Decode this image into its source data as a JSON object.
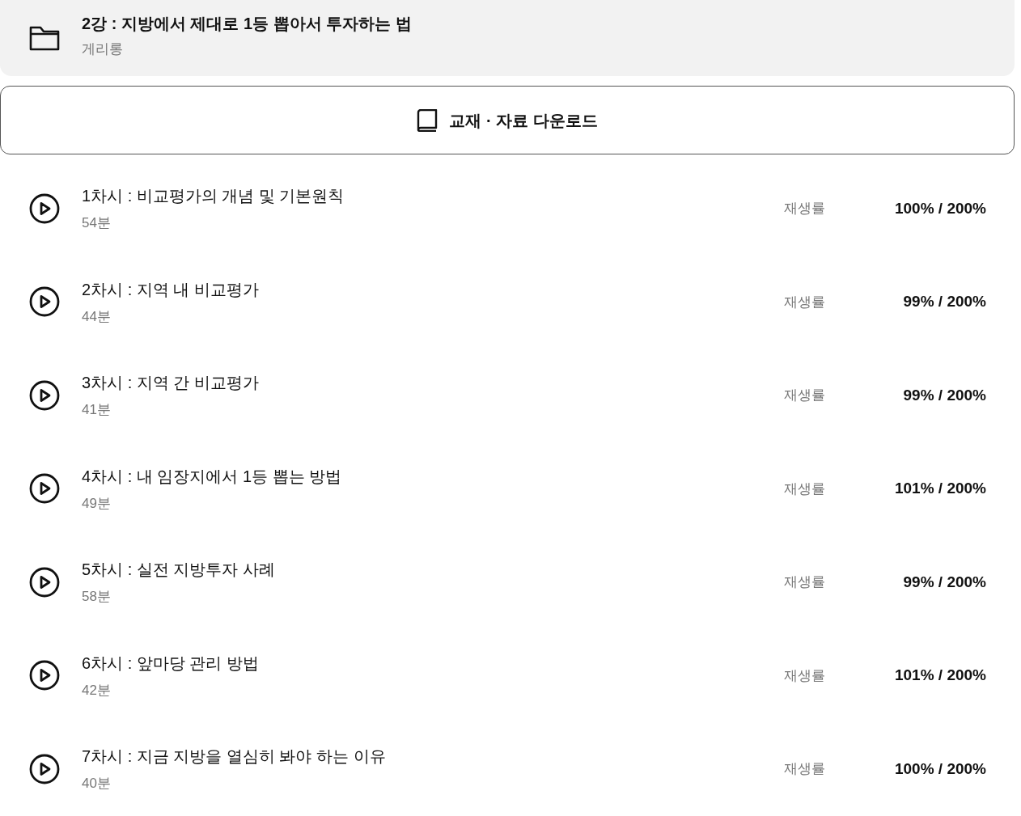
{
  "course": {
    "title": "2강 : 지방에서 제대로 1등 뽑아서 투자하는 법",
    "author": "게리롱"
  },
  "download_button": {
    "label": "교재 · 자료 다운로드"
  },
  "lessons": [
    {
      "title": "1차시 : 비교평가의 개념 및 기본원칙",
      "duration": "54분",
      "rate_label": "재생률",
      "rate": "100% / 200%"
    },
    {
      "title": "2차시 : 지역 내 비교평가",
      "duration": "44분",
      "rate_label": "재생률",
      "rate": "99% / 200%"
    },
    {
      "title": "3차시 : 지역 간 비교평가",
      "duration": "41분",
      "rate_label": "재생률",
      "rate": "99% / 200%"
    },
    {
      "title": "4차시 : 내 임장지에서 1등 뽑는 방법",
      "duration": "49분",
      "rate_label": "재생률",
      "rate": "101% / 200%"
    },
    {
      "title": "5차시 : 실전 지방투자 사례",
      "duration": "58분",
      "rate_label": "재생률",
      "rate": "99% / 200%"
    },
    {
      "title": "6차시 : 앞마당 관리 방법",
      "duration": "42분",
      "rate_label": "재생률",
      "rate": "101% / 200%"
    },
    {
      "title": "7차시 : 지금 지방을 열심히 봐야 하는 이유",
      "duration": "40분",
      "rate_label": "재생률",
      "rate": "100% / 200%"
    }
  ]
}
